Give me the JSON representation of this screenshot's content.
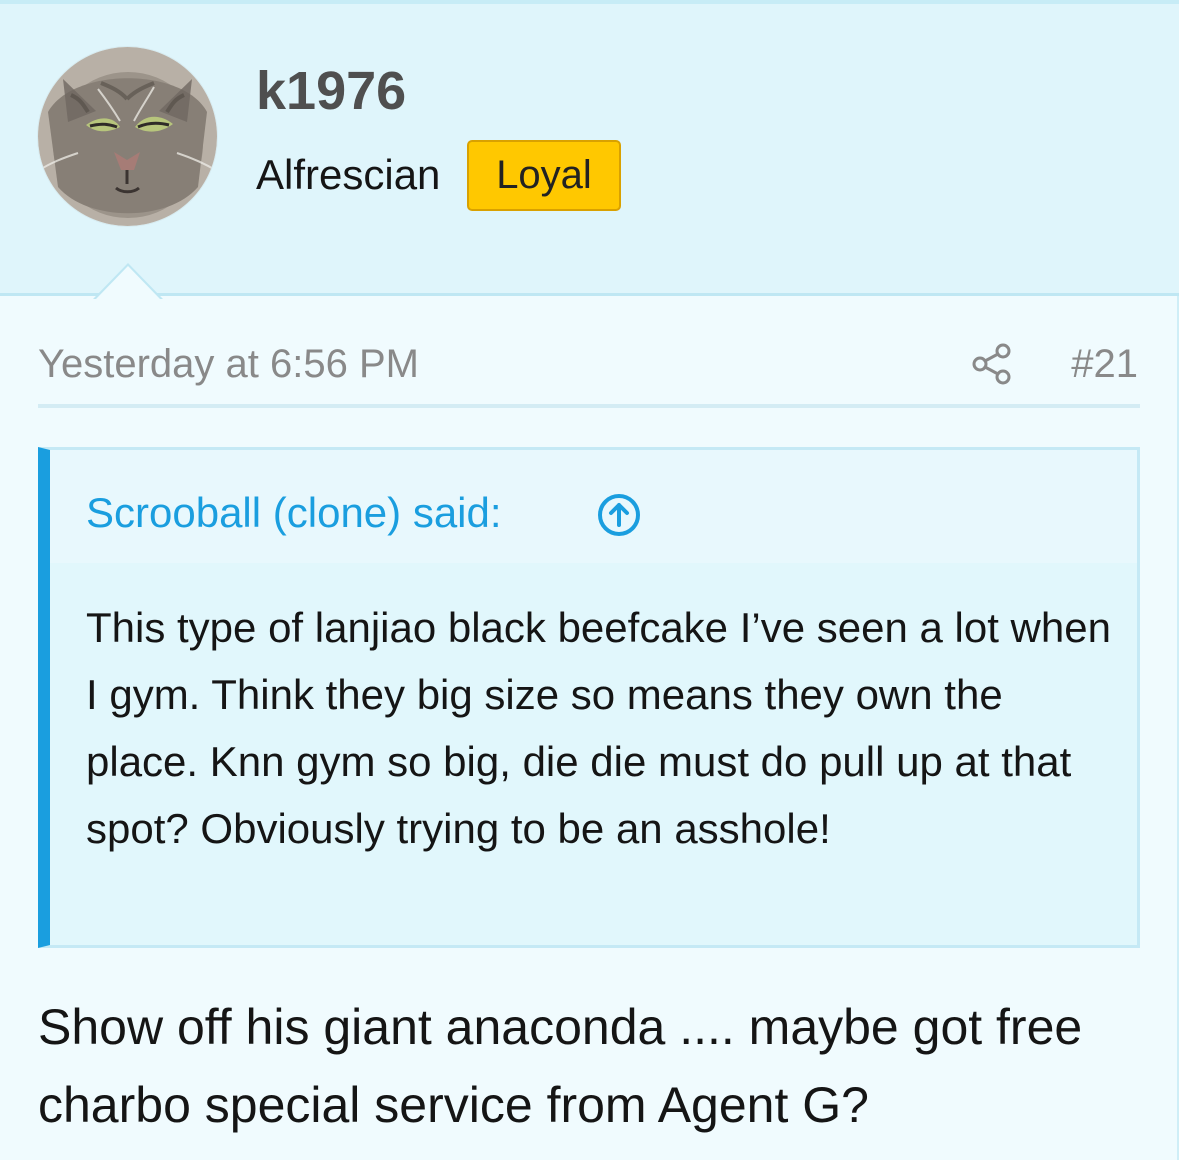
{
  "user": {
    "name": "k1976",
    "title": "Alfrescian",
    "badge": "Loyal",
    "avatar_icon": "cat-face-avatar"
  },
  "post": {
    "timestamp": "Yesterday at 6:56 PM",
    "share_icon": "share-icon",
    "number": "#21"
  },
  "quote": {
    "author_line": "Scrooball (clone) said:",
    "jump_icon": "arrow-up-circle-icon",
    "text": "This type of lanjiao black beefcake I’ve seen a lot when I gym. Think they big size so means they own the place. Knn gym so big, die die must do pull up at that spot? Obviously trying to be an asshole!"
  },
  "message": {
    "text": "Show off his giant anaconda .... maybe got free charbo special service from Agent G?"
  },
  "colors": {
    "header_background": "#dff5fb",
    "post_background": "#f0fbfe",
    "quote_accent": "#1a9edf",
    "badge_background": "#ffc800",
    "meta_text": "#898989"
  }
}
